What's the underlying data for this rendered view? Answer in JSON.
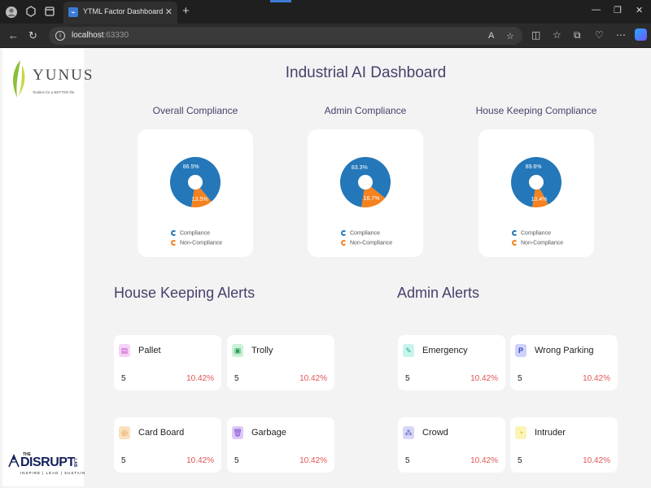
{
  "browser": {
    "tab_title": "YTML Factor Dashboard",
    "url_host": "localhost",
    "url_port": ":63330"
  },
  "sidebar": {
    "logo_text": "YUNUS",
    "logo_tagline": "Textiles for a BETTER life",
    "footer_brand_small": "THE",
    "footer_brand": "DISRUPT",
    "footer_lab": "LAB",
    "footer_tagline": "INSPIRE | LEAD | SUSTAIN"
  },
  "main": {
    "title": "Industrial AI Dashboard",
    "legend": {
      "compliance": "Compliance",
      "non_compliance": "Non-Compliance"
    },
    "charts": [
      {
        "title": "Overall Compliance",
        "compliance_label": "86.5%",
        "non_compliance_label": "13.5%"
      },
      {
        "title": "Admin Compliance",
        "compliance_label": "83.3%",
        "non_compliance_label": "16.7%"
      },
      {
        "title": "House Keeping Compliance",
        "compliance_label": "89.6%",
        "non_compliance_label": "10.4%"
      }
    ],
    "housekeeping_alerts": {
      "title": "House Keeping Alerts",
      "items": [
        {
          "label": "Pallet",
          "count": "5",
          "percent": "10.42%",
          "icon": "pallet-icon"
        },
        {
          "label": "Trolly",
          "count": "5",
          "percent": "10.42%",
          "icon": "trolley-icon"
        },
        {
          "label": "Card Board",
          "count": "5",
          "percent": "10.42%",
          "icon": "cardboard-icon"
        },
        {
          "label": "Garbage",
          "count": "5",
          "percent": "10.42%",
          "icon": "garbage-icon"
        }
      ]
    },
    "admin_alerts": {
      "title": "Admin Alerts",
      "items": [
        {
          "label": "Emergency",
          "count": "5",
          "percent": "10.42%",
          "icon": "emergency-icon"
        },
        {
          "label": "Wrong Parking",
          "count": "5",
          "percent": "10.42%",
          "icon": "parking-icon"
        },
        {
          "label": "Crowd",
          "count": "5",
          "percent": "10.42%",
          "icon": "crowd-icon"
        },
        {
          "label": "Intruder",
          "count": "5",
          "percent": "10.42%",
          "icon": "intruder-icon"
        }
      ]
    }
  },
  "colors": {
    "compliance": "#2477b8",
    "non_compliance": "#f5821f",
    "heading": "#4a3f6b",
    "alert_percent": "#e05555"
  },
  "chart_data": [
    {
      "type": "pie",
      "title": "Overall Compliance",
      "categories": [
        "Compliance",
        "Non-Compliance"
      ],
      "values": [
        86.5,
        13.5
      ]
    },
    {
      "type": "pie",
      "title": "Admin Compliance",
      "categories": [
        "Compliance",
        "Non-Compliance"
      ],
      "values": [
        83.3,
        16.7
      ]
    },
    {
      "type": "pie",
      "title": "House Keeping Compliance",
      "categories": [
        "Compliance",
        "Non-Compliance"
      ],
      "values": [
        89.6,
        10.4
      ]
    }
  ]
}
